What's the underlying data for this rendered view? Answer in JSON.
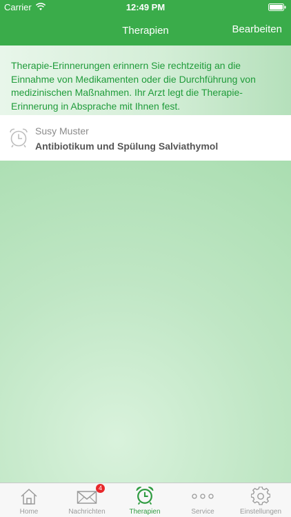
{
  "status": {
    "carrier": "Carrier",
    "time": "12:49 PM"
  },
  "nav": {
    "title": "Therapien",
    "edit_label": "Bearbeiten"
  },
  "info": {
    "text": "Therapie-Erinnerungen erinnern Sie rechtzeitig an die Einnahme von Medikamenten oder die Durchführung von medizinischen Maßnahmen. Ihr Arzt legt die Therapie-Erinnerung in Absprache mit Ihnen fest."
  },
  "list": {
    "items": [
      {
        "name": "Susy Muster",
        "therapy": "Antibiotikum und Spülung Salviathymol",
        "icon": "alarm-clock-icon"
      }
    ]
  },
  "tabs": [
    {
      "label": "Home",
      "icon": "home-icon"
    },
    {
      "label": "Nachrichten",
      "icon": "envelope-icon",
      "badge": "4"
    },
    {
      "label": "Therapien",
      "icon": "alarm-clock-icon",
      "active": true
    },
    {
      "label": "Service",
      "icon": "dots-icon"
    },
    {
      "label": "Einstellungen",
      "icon": "gear-icon"
    }
  ],
  "colors": {
    "brand_green": "#3aac4a",
    "text_green": "#1f9b3a",
    "badge_red": "#e8282b"
  }
}
